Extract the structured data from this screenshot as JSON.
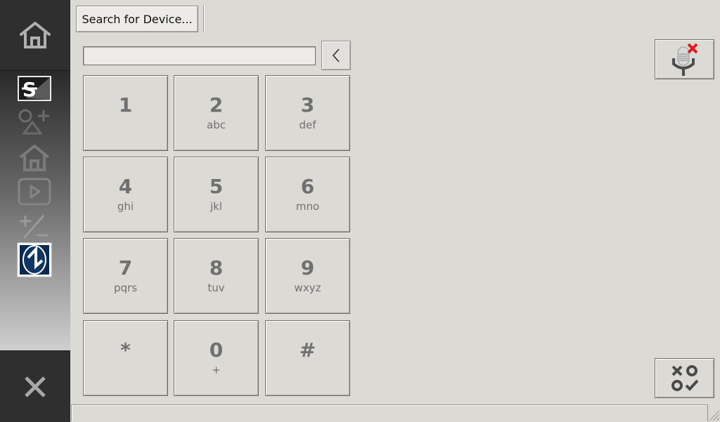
{
  "sidebar": {
    "top_icon": "home-icon",
    "bottom_icon": "close-icon",
    "items": [
      {
        "name": "dollar-icon"
      },
      {
        "name": "add-contact-icon"
      },
      {
        "name": "home-outline-icon"
      },
      {
        "name": "play-icon"
      },
      {
        "name": "plus-minus-icon"
      },
      {
        "name": "app-logo-icon"
      }
    ]
  },
  "toolbar": {
    "search_label": "Search for Device..."
  },
  "dialpad": {
    "input_value": "",
    "keys": [
      {
        "digit": "1",
        "letters": ""
      },
      {
        "digit": "2",
        "letters": "abc"
      },
      {
        "digit": "3",
        "letters": "def"
      },
      {
        "digit": "4",
        "letters": "ghi"
      },
      {
        "digit": "5",
        "letters": "jkl"
      },
      {
        "digit": "6",
        "letters": "mno"
      },
      {
        "digit": "7",
        "letters": "pqrs"
      },
      {
        "digit": "8",
        "letters": "tuv"
      },
      {
        "digit": "9",
        "letters": "wxyz"
      },
      {
        "digit": "*",
        "letters": ""
      },
      {
        "digit": "0",
        "letters": "+"
      },
      {
        "digit": "#",
        "letters": ""
      }
    ]
  },
  "colors": {
    "background": "#dcdad5",
    "key_text": "#707070",
    "mute_x": "#e01b1b"
  }
}
